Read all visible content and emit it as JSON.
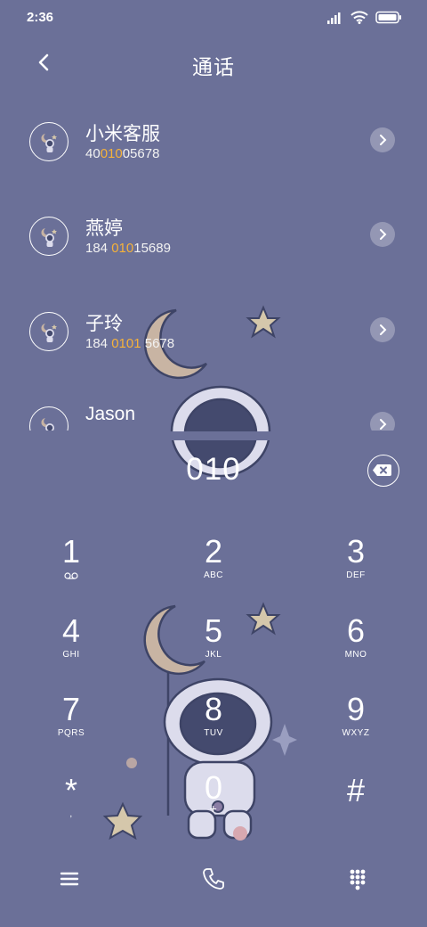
{
  "status_bar": {
    "time": "2:36"
  },
  "header": {
    "title": "通话"
  },
  "contacts": [
    {
      "name": "小米客服",
      "num_pre": "40",
      "num_hl": "010",
      "num_post": "05678"
    },
    {
      "name": "燕婷",
      "num_pre": "184 ",
      "num_hl": "010",
      "num_post": "15689"
    },
    {
      "name": "子玲",
      "num_pre": "184 ",
      "num_hl": "0101",
      "num_post": " 5678"
    },
    {
      "name": "Jason",
      "num_pre": "",
      "num_hl": "",
      "num_post": ""
    }
  ],
  "dialer": {
    "number": "010",
    "keys": [
      {
        "digit": "1",
        "letters": ""
      },
      {
        "digit": "2",
        "letters": "ABC"
      },
      {
        "digit": "3",
        "letters": "DEF"
      },
      {
        "digit": "4",
        "letters": "GHI"
      },
      {
        "digit": "5",
        "letters": "JKL"
      },
      {
        "digit": "6",
        "letters": "MNO"
      },
      {
        "digit": "7",
        "letters": "PQRS"
      },
      {
        "digit": "8",
        "letters": "TUV"
      },
      {
        "digit": "9",
        "letters": "WXYZ"
      },
      {
        "digit": "*",
        "letters": ","
      },
      {
        "digit": "0",
        "letters": "+"
      },
      {
        "digit": "#",
        "letters": ""
      }
    ]
  },
  "icons": {
    "back": "chevron-left-icon",
    "backspace": "backspace-icon",
    "voicemail": "voicemail-icon",
    "menu": "menu-icon",
    "call": "phone-icon",
    "keypad": "keypad-icon"
  },
  "colors": {
    "background": "#6b7098",
    "highlight": "#f6b23a",
    "moon": "#c8b4a3",
    "star": "#d5c7ab"
  }
}
